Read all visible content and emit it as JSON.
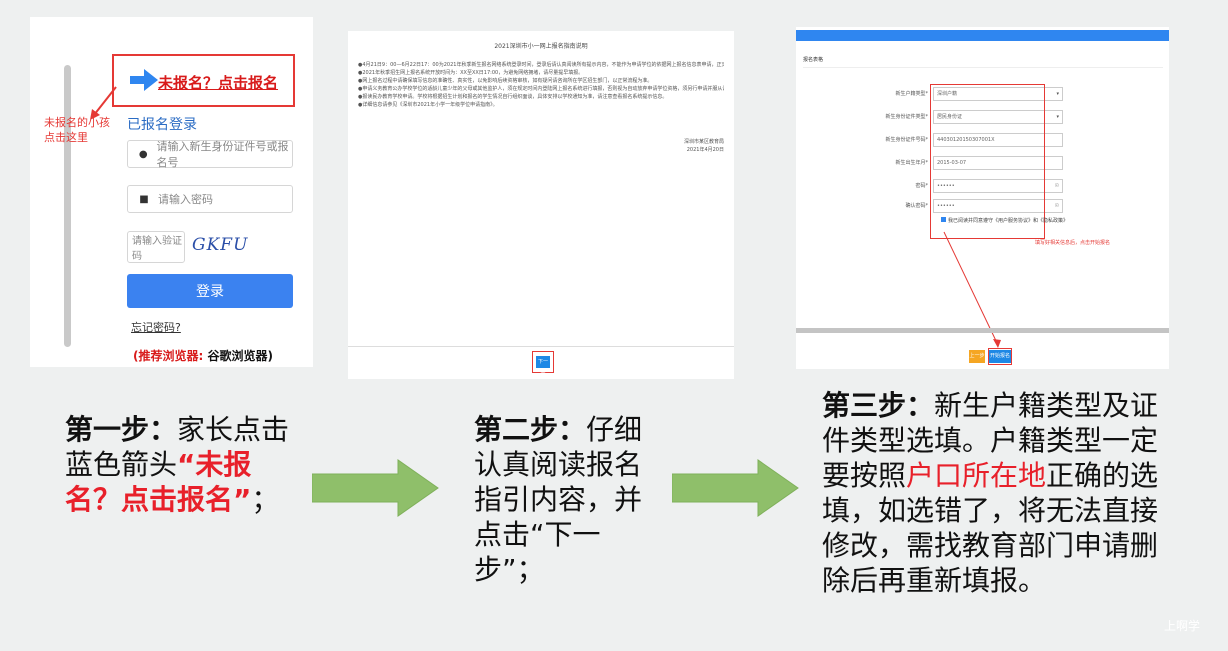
{
  "panel1": {
    "cta_label": "未报名？点击报名",
    "hint_note": "未报名的小孩\n点击这里",
    "login_title": "已报名登录",
    "id_placeholder": "请输入新生身份证件号或报名号",
    "password_placeholder": "请输入密码",
    "captcha_placeholder": "请输入验证码",
    "captcha_text": "GKFU",
    "login_button": "登录",
    "forgot_password": "忘记密码?",
    "browser_label": "(推荐浏览器:",
    "browser_name": "谷歌浏览器)"
  },
  "panel2": {
    "doc_title": "2021深圳市小一网上报名指南说明",
    "doc_lines": [
      "●4月21日9：00—6月22日17：00为2021年秋季新生报名网络系统登录时间，登录后请认真阅读所有提示内容，不能作为申请学位的依据网上报名信息表申请，正式开始网上报名流程后需按照提示填写信息。",
      "●2021年秋季招生网上报名系统开放时间为：XX至XX日17:00，为避免网络拥堵，请尽量提早填报。",
      "●网上报名过程中请确保填写信息的准确性、真实性，以免影响后续资格审核，如有疑问请咨询所在学区招生部门，以正常流程为准。",
      "●申请义务教育公办学校学位的适龄儿童少年的父母或其他监护人，须在规定时间内登陆网上报名系统进行填报，否则视为自动放弃申请学位资格，须另行申请并服从调剂安排。",
      "●报读民办教育学校申请。学校将根据招生计划和报名的学生情况自行组织面谈，具体安排以学校通知为准，请注意查看报名系统提示信息。",
      "●详细信息请参见《深圳市2021年小学一年级学位申请指南》。"
    ],
    "signature_org": "深圳市某区教育局",
    "signature_date": "2021年4月20日",
    "next_button": "下一步"
  },
  "panel3": {
    "form_title": "报名表格",
    "fields": [
      {
        "label": "新生户籍类型*",
        "value": "深圳户籍",
        "type": "select"
      },
      {
        "label": "新生身份证件类型*",
        "value": "居民身份证",
        "type": "select"
      },
      {
        "label": "新生身份证件号码*",
        "value": "44030120150307001X",
        "type": "text"
      },
      {
        "label": "新生出生年月*",
        "value": "2015-03-07",
        "type": "text"
      },
      {
        "label": "密码*",
        "value": "••••••",
        "type": "password"
      },
      {
        "label": "确认密码*",
        "value": "••••••",
        "type": "password"
      }
    ],
    "agree_text": "我已阅读并同意遵守《用户服务协议》和《隐私政策》",
    "callout_text": "填写好相关信息后，点击开始报名",
    "prev_button": "上一步",
    "register_button": "开始报名"
  },
  "steps": [
    {
      "title": "第一步：",
      "body_before": "家长点击蓝色箭头",
      "highlight": "“未报名？点击报名”",
      "body_after": "；"
    },
    {
      "title": "第二步：",
      "body_before": "仔细认真阅读报名指引内容，并点击“下一步”；",
      "highlight": "",
      "body_after": ""
    },
    {
      "title": "第三步：",
      "body_before": "新生户籍类型及证件类型选填。户籍类型一定要按照",
      "highlight": "户口所在地",
      "body_after": "正确的选填，如选错了，将无法直接修改，需找教育部门申请删除后再重新填报。"
    }
  ],
  "watermark": "上啊学",
  "colors": {
    "accent_red": "#e8202a",
    "accent_blue": "#2f86f0",
    "flow_arrow_green": "#8fbf6a"
  }
}
